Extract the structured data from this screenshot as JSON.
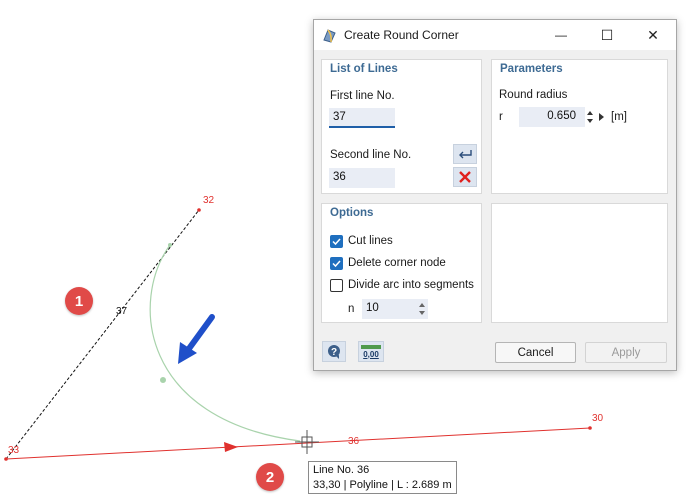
{
  "drawing": {
    "nodes": [
      {
        "id": "node-32",
        "label": "32"
      },
      {
        "id": "node-33",
        "label": "33"
      },
      {
        "id": "node-30",
        "label": "30"
      }
    ],
    "lines": [
      {
        "id": "line-37",
        "label": "37"
      },
      {
        "id": "line-36",
        "label": "36"
      }
    ],
    "badges": [
      "1",
      "2"
    ],
    "tooltip": {
      "line1": "Line No. 36",
      "line2": "33,30 | Polyline  | L : 2.689 m"
    },
    "colors": {
      "node": "#e0312e",
      "arc": "#a9d3ac",
      "arrow": "#1f4fc9",
      "badge": "#e04a48"
    }
  },
  "dialog": {
    "title": "Create Round Corner",
    "window_buttons": {
      "minimize": "—",
      "maximize": "☐",
      "close": "✕"
    },
    "list_of_lines": {
      "header": "List of Lines",
      "first_label": "First line No.",
      "first_value": "37",
      "second_label": "Second line No.",
      "second_value": "36"
    },
    "parameters": {
      "header": "Parameters",
      "radius_label": "Round radius",
      "symbol": "r",
      "value": "0.650",
      "unit": "[m]"
    },
    "options": {
      "header": "Options",
      "cut_lines": {
        "label": "Cut lines",
        "checked": true
      },
      "delete_corner_node": {
        "label": "Delete corner node",
        "checked": true
      },
      "divide_arc": {
        "label": "Divide arc into segments",
        "checked": false
      },
      "n_label": "n",
      "n_value": "10"
    },
    "footer": {
      "units_icon_text": "0,00",
      "cancel": "Cancel",
      "apply": "Apply"
    }
  }
}
